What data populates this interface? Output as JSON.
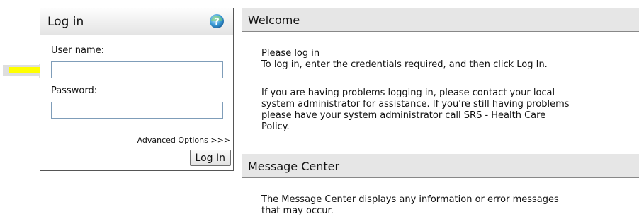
{
  "login": {
    "title": "Log in",
    "username_label": "User name:",
    "username_value": "",
    "password_label": "Password:",
    "password_value": "",
    "advanced_options": "Advanced Options >>>",
    "login_button": "Log In"
  },
  "welcome": {
    "title": "Welcome",
    "line1": "Please log in",
    "line2": "To log in, enter the credentials required, and then click Log In.",
    "para2_line1": "If you are having problems logging in, please contact your local",
    "para2_line2": "system administrator for assistance. If you're still having problems",
    "para2_line3": "please have your system administrator call SRS - Health Care",
    "para2_line4": "Policy."
  },
  "message_center": {
    "title": "Message Center",
    "line1": "The Message Center displays any information or error messages",
    "line2": "that may occur."
  },
  "icons": {
    "help": "help-icon",
    "arrow": "arrow-pointer-icon"
  },
  "colors": {
    "arrow_fill": "#ffff00",
    "panel_border": "#555555",
    "section_bg": "#e6e6e6"
  }
}
